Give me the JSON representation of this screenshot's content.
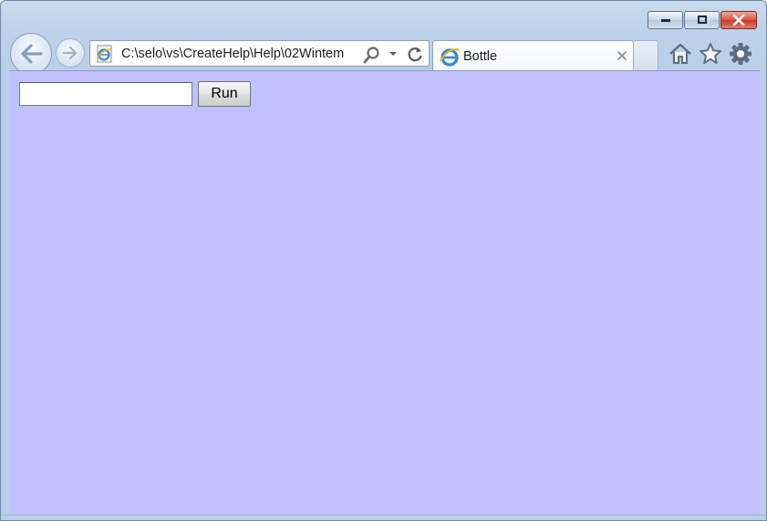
{
  "window": {
    "controls": [
      "minimize-icon",
      "restore-icon",
      "close-icon"
    ]
  },
  "nav": {
    "back_icon": "back-arrow-icon",
    "forward_icon": "forward-arrow-icon"
  },
  "address_bar": {
    "url": "C:\\selo\\vs\\CreateHelp\\Help\\02Wintem",
    "icons": [
      "ie-page-icon",
      "search-icon",
      "dropdown-icon",
      "refresh-icon"
    ]
  },
  "tabs": [
    {
      "label": "Bottle",
      "icon": "ie-page-icon",
      "close_icon": "close-icon"
    }
  ],
  "toolbar_icons": [
    "home-icon",
    "star-icon",
    "gear-icon"
  ],
  "page": {
    "input_value": "",
    "run_label": "Run",
    "background_color": "#c0c0ff"
  }
}
